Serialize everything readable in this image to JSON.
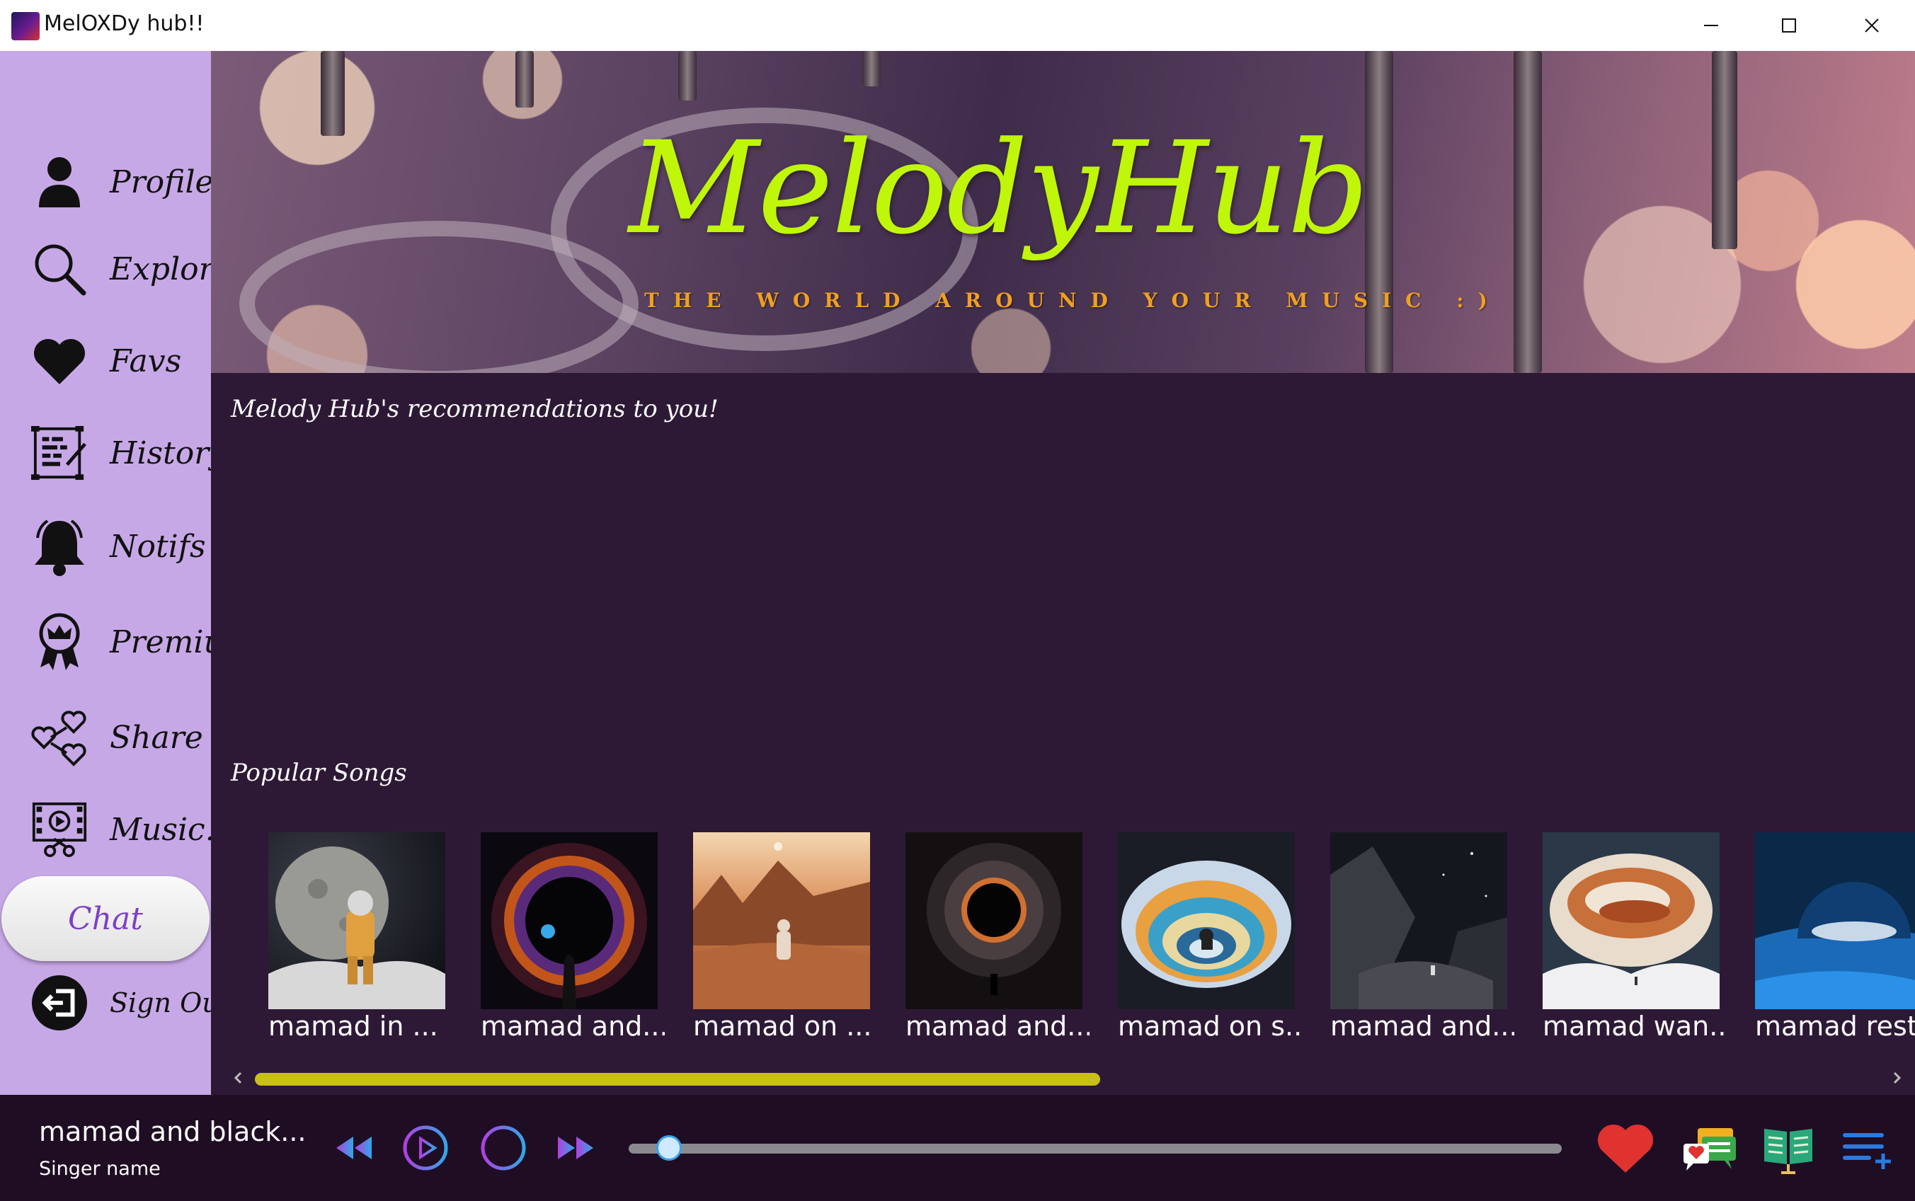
{
  "window": {
    "title": "MelOXDy hub!!",
    "controls": [
      "minimize",
      "maximize",
      "close"
    ]
  },
  "sidebar": {
    "background": "#c7a8e7",
    "items": [
      {
        "label": "Profile",
        "icon": "person-icon"
      },
      {
        "label": "Explore",
        "icon": "search-icon"
      },
      {
        "label": "Favs",
        "icon": "heart-icon"
      },
      {
        "label": "History",
        "icon": "history-icon"
      },
      {
        "label": "Notifs",
        "icon": "bell-icon"
      },
      {
        "label": "Premium",
        "icon": "crown-badge-icon"
      },
      {
        "label": "Share",
        "icon": "share-hearts-icon"
      },
      {
        "label": "Music...",
        "icon": "film-music-icon"
      }
    ],
    "chat_label": "Chat",
    "sign_out_label": "Sign Out"
  },
  "banner": {
    "logo": "MelodyHub",
    "tagline": "THE WORLD AROUND YOUR MUSIC :)"
  },
  "sections": {
    "recommendations_title": "Melody Hub's recommendations to you!",
    "popular_title": "Popular Songs"
  },
  "popular_songs": [
    {
      "title": "mamad in ...",
      "art": "astronaut-on-moon"
    },
    {
      "title": "mamad and...",
      "art": "fiery-portal"
    },
    {
      "title": "mamad on ...",
      "art": "desert-planet"
    },
    {
      "title": "mamad and...",
      "art": "black-hole"
    },
    {
      "title": "mamad on s...",
      "art": "rainbow-swirl"
    },
    {
      "title": "mamad and...",
      "art": "asteroid-field"
    },
    {
      "title": "mamad wan...",
      "art": "gas-giant-clouds"
    },
    {
      "title": "mamad rest...",
      "art": "blue-planet"
    }
  ],
  "player": {
    "now_playing_title": "mamad and black...",
    "singer": "Singer name",
    "progress": 0.04
  },
  "colors": {
    "main_bg": "#2d1936",
    "player_bg": "#1f0d24",
    "logo_green": "#bff60a",
    "tagline_orange": "#f0a020",
    "accent_purple": "#b040e0",
    "accent_blue": "#30a8e8",
    "scroll_thumb": "#c8c018",
    "heart_red": "#e0322e"
  }
}
